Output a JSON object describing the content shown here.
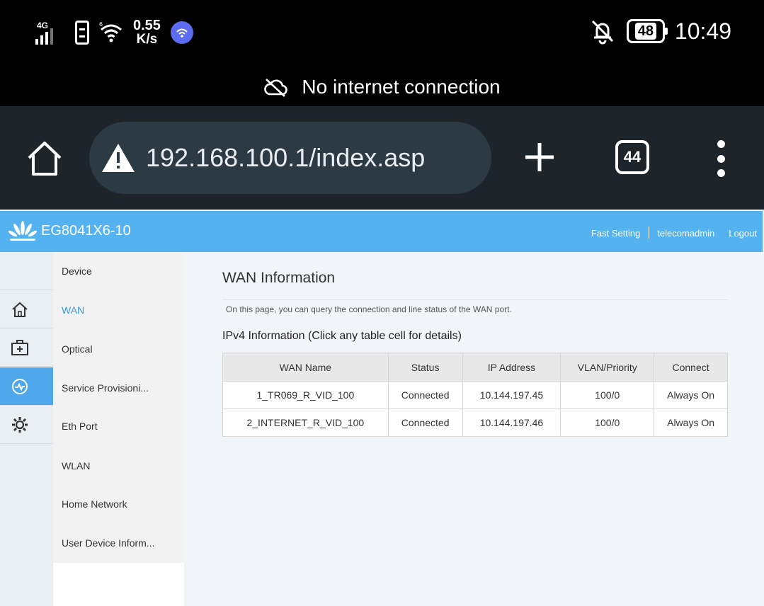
{
  "status_bar": {
    "network_type": "4G",
    "net_speed_value": "0.55",
    "net_speed_unit": "K/s",
    "battery_level": "48",
    "time": "10:49"
  },
  "banner": {
    "text": "No internet connection"
  },
  "browser": {
    "url": "192.168.100.1/index.asp",
    "tab_count": "44"
  },
  "router": {
    "model": "EG8041X6-10",
    "header_links": {
      "fast_setting": "Fast Setting",
      "user": "telecomadmin",
      "logout": "Logout"
    },
    "rail_icons": [
      "home-icon",
      "medical-box-icon",
      "status-gauge-icon",
      "gear-icon"
    ],
    "menu": [
      {
        "label": "Device"
      },
      {
        "label": "WAN"
      },
      {
        "label": "Optical"
      },
      {
        "label": "Service Provisioni..."
      },
      {
        "label": "Eth Port"
      },
      {
        "label": "WLAN"
      },
      {
        "label": "Home Network"
      },
      {
        "label": "User Device Inform..."
      }
    ],
    "active_menu": "WAN"
  },
  "content": {
    "title": "WAN Information",
    "description": "On this page, you can query the connection and line status of the WAN port.",
    "section_title": "IPv4 Information (Click any table cell for details)",
    "table": {
      "columns": [
        "WAN Name",
        "Status",
        "IP Address",
        "VLAN/Priority",
        "Connect"
      ],
      "rows": [
        [
          "1_TR069_R_VID_100",
          "Connected",
          "10.144.197.45",
          "100/0",
          "Always On"
        ],
        [
          "2_INTERNET_R_VID_100",
          "Connected",
          "10.144.197.46",
          "100/0",
          "Always On"
        ]
      ]
    }
  },
  "colors": {
    "header_blue": "#55b2f0",
    "active_blue": "#4ea7ea",
    "link_blue": "#3a9be6",
    "browser_bar": "#1d252b",
    "url_box": "#2c3a44"
  }
}
